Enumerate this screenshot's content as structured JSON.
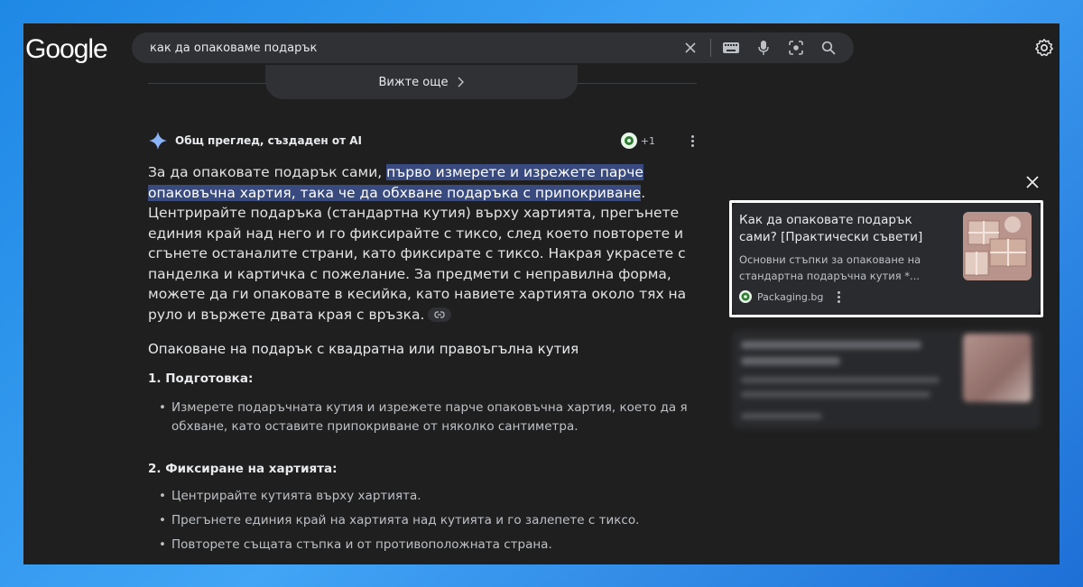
{
  "header": {
    "logo": "Google",
    "search_value": "как да опаковаме подарък"
  },
  "see_more": {
    "label": "Вижте още"
  },
  "ai_overview": {
    "title": "Общ преглед, създаден от AI",
    "contributors": "+1",
    "intro_plain": "За да опаковате подарък сами, ",
    "intro_highlight": "първо измерете и изрежете парче опаковъчна хартия, така че да обхване подаръка с припокриване",
    "intro_rest": ". Центрирайте подаръка (стандартна кутия) върху хартията, прегънете единия край над него и го фиксирайте с тиксо, след което повторете и сгънете останалите страни, като фиксирате с тиксо. Накрая украсете с панделка и картичка с пожелание. За предмети с неправилна форма, можете да ги опаковате в кесийка, като навиете хартията около тях на руло и вържете двата края с връзка."
  },
  "section": {
    "heading": "Опаковане на подарък с квадратна или правоъгълна кутия",
    "step1_title": "1. Подготовка:",
    "step1_items": [
      "Измерете подаръчната кутия и изрежете парче опаковъчна хартия, което да я обхване, като оставите припокриване от няколко сантиметра."
    ],
    "step2_title": "2. Фиксиране на хартията:",
    "step2_items": [
      "Центрирайте кутията върху хартията.",
      "Прегънете единия край на хартията над кутията и го залепете с тиксо.",
      "Повторете същата стъпка и от противоположната страна."
    ]
  },
  "source_card": {
    "title": "Как да опаковате подарък сами? [Практически съвети]",
    "description": "Основни стъпки за опаковане на стандартна подаръчна кутия *...",
    "source": "Packaging.bg"
  },
  "colors": {
    "highlight": "#394a7e",
    "background": "#1f1f1f",
    "card": "#2a2b2e",
    "frame": "#1e88e5"
  }
}
